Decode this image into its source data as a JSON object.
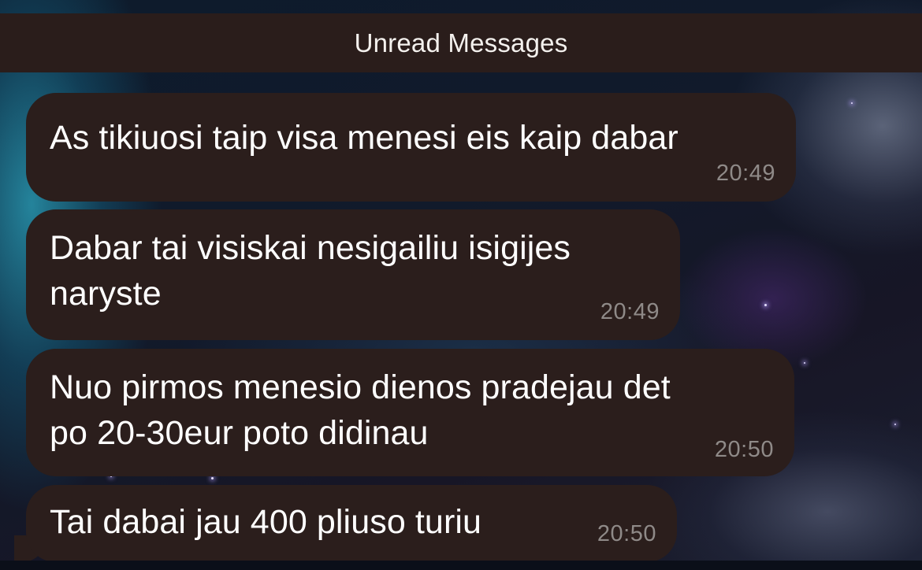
{
  "header": {
    "title": "Unread Messages"
  },
  "messages": [
    {
      "text": "As tikiuosi taip visa menesi eis kaip dabar",
      "time": "20:49"
    },
    {
      "text": "Dabar tai visiskai nesigailiu isigijes\nnaryste",
      "time": "20:49"
    },
    {
      "text": "Nuo pirmos menesio dienos pradejau det\npo 20-30eur poto didinau",
      "time": "20:50"
    },
    {
      "text": "Tai dabai jau 400 pliuso turiu",
      "time": "20:50"
    }
  ],
  "colors": {
    "bubble": "#2b1e1c",
    "header_bar": "#2a1d1b",
    "text": "#ffffff",
    "timestamp": "#8f8a88"
  }
}
